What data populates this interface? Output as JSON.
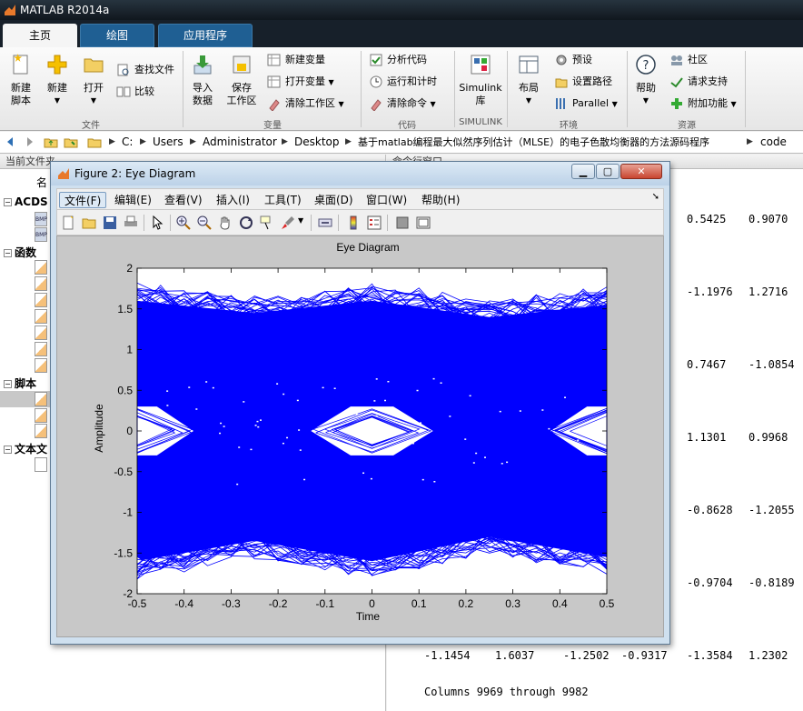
{
  "app": {
    "title": "MATLAB R2014a"
  },
  "tabs": [
    {
      "label": "主页"
    },
    {
      "label": "绘图"
    },
    {
      "label": "应用程序"
    }
  ],
  "ribbon": {
    "new_script": "新建\n脚本",
    "new": "新建",
    "open": "打开",
    "find_files": "查找文件",
    "compare": "比较",
    "import_data": "导入\n数据",
    "save_workspace": "保存\n工作区",
    "new_variable": "新建变量",
    "open_variable": "打开变量",
    "clear_workspace": "清除工作区",
    "analyze_code": "分析代码",
    "run_and_time": "运行和计时",
    "clear_commands": "清除命令",
    "simulink": "Simulink\n库",
    "layout": "布局",
    "preferences": "预设",
    "set_path": "设置路径",
    "parallel": "Parallel",
    "help": "帮助",
    "community": "社区",
    "request_support": "请求支持",
    "add_ons": "附加功能",
    "groups": {
      "file": "文件",
      "variable": "变量",
      "code": "代码",
      "simulink": "SIMULINK",
      "environment": "环境",
      "resources": "资源"
    }
  },
  "address": {
    "crumbs": [
      "C:",
      "Users",
      "Administrator",
      "Desktop",
      "基于matlab编程最大似然序列估计（MLSE）的电子色散均衡器的方法源码程序",
      "code"
    ]
  },
  "current_folder": {
    "header": "当前文件夹",
    "col_name": "名",
    "sections": [
      {
        "label": "ACDS"
      },
      {
        "label": "函数"
      },
      {
        "label": "脚本"
      },
      {
        "label": "文本文"
      }
    ],
    "bmp_label": "BMP"
  },
  "command_window": {
    "header": "命令行窗口",
    "rows": [
      [
        "",
        "",
        "",
        "",
        "0.5425",
        "0.9070"
      ],
      [
        "",
        "",
        "",
        "",
        "-1.1976",
        "1.2716"
      ],
      [
        "",
        "",
        "",
        "",
        "0.7467",
        "-1.0854"
      ],
      [
        "",
        "",
        "",
        "",
        "1.1301",
        "0.9968"
      ],
      [
        "",
        "",
        "",
        "",
        "-0.8628",
        "-1.2055"
      ],
      [
        "",
        "",
        "",
        "",
        "-0.9704",
        "-0.8189"
      ],
      [
        "-1.1454",
        "1.6037",
        "-1.2502",
        "-0.9317",
        "-1.3584",
        "1.2302"
      ]
    ],
    "columns_text": "Columns 9969 through 9982"
  },
  "figure": {
    "title": "Figure 2: Eye Diagram",
    "menu": [
      {
        "label": "文件(F)"
      },
      {
        "label": "编辑(E)"
      },
      {
        "label": "查看(V)"
      },
      {
        "label": "插入(I)"
      },
      {
        "label": "工具(T)"
      },
      {
        "label": "桌面(D)"
      },
      {
        "label": "窗口(W)"
      },
      {
        "label": "帮助(H)"
      }
    ],
    "toolbar_icons": [
      "new-figure-icon",
      "open-file-icon",
      "save-icon",
      "print-icon",
      "pointer-icon",
      "zoom-in-icon",
      "zoom-out-icon",
      "pan-hand-icon",
      "rotate-icon",
      "data-cursor-icon",
      "brush-icon",
      "link-icon",
      "colorbar-icon",
      "legend-icon",
      "hide-tools-icon",
      "show-tools-icon"
    ]
  },
  "chart_data": {
    "type": "line",
    "title": "Eye Diagram",
    "xlabel": "Time",
    "ylabel": "Amplitude",
    "xlim": [
      -0.5,
      0.5
    ],
    "ylim": [
      -2,
      2
    ],
    "xticks": [
      -0.5,
      -0.4,
      -0.3,
      -0.2,
      -0.1,
      0,
      0.1,
      0.2,
      0.3,
      0.4,
      0.5
    ],
    "yticks": [
      -2,
      -1.5,
      -1,
      -0.5,
      0,
      0.5,
      1,
      1.5,
      2
    ],
    "xtick_labels": [
      "-0.5",
      "-0.4",
      "-0.3",
      "-0.2",
      "-0.1",
      "0",
      "0.1",
      "0.2",
      "0.3",
      "0.4",
      "0.5"
    ],
    "ytick_labels": [
      "-2",
      "-1.5",
      "-1",
      "-0.5",
      "0",
      "0.5",
      "1",
      "1.5",
      "2"
    ],
    "color": "#0000ff",
    "series": [
      {
        "values_description": "",
        "x": [
          -0.5,
          -0.25,
          0,
          0.25,
          0.5
        ],
        "upper_envelope": [
          1.8,
          1.65,
          1.8,
          1.6,
          1.75
        ],
        "lower_envelope": [
          -1.8,
          -1.55,
          -1.8,
          -1.5,
          -1.75
        ]
      }
    ]
  }
}
